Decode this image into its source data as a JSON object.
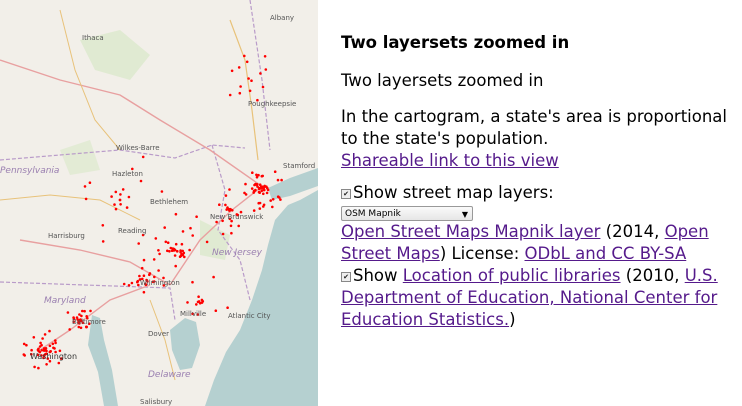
{
  "map": {
    "labels": {
      "ithaca": "Ithaca",
      "albany": "Albany",
      "poughkeepsie": "Poughkeepsie",
      "wilkes_barre": "Wilkes-Barre",
      "hazleton": "Hazleton",
      "stamford": "Stamford",
      "bethlehem": "Bethlehem",
      "new_brunswick": "New Brunswick",
      "harrisburg": "Harrisburg",
      "reading": "Reading",
      "new_jersey": "New Jersey",
      "pennsylvania": "Pennsylvania",
      "wilmington": "Wilmington",
      "maryland": "Maryland",
      "baltimore": "Baltimore",
      "millville": "Millville",
      "atlantic_city": "Atlantic City",
      "washington": "Washington",
      "dover": "Dover",
      "delaware": "Delaware",
      "salisbury": "Salisbury"
    }
  },
  "panel": {
    "title": "Two layersets zoomed in",
    "subtitle": "Two layersets zoomed in",
    "description": "In the cartogram, a state's area is proportional to the state's population.",
    "share_link": "Shareable link to this view",
    "street_toggle_label": "Show street map layers:",
    "street_select_value": "OSM Mapnik",
    "osm_link": "Open Street Maps Mapnik layer",
    "osm_year": " (2014, ",
    "osm_source_link": "Open Street Maps",
    "license_text": ") License: ",
    "license_link": "ODbL and CC BY-SA",
    "libraries_show": "Show ",
    "libraries_link": "Location of public libraries",
    "libraries_year": " (2010, ",
    "libraries_source_link": "U.S. Department of Education, National Center for Education Statistics.",
    "libraries_close": ")"
  },
  "colors": {
    "link": "#551a8b",
    "points": "#ff0000",
    "water": "#b5d0d0",
    "land": "#f2efe9"
  }
}
